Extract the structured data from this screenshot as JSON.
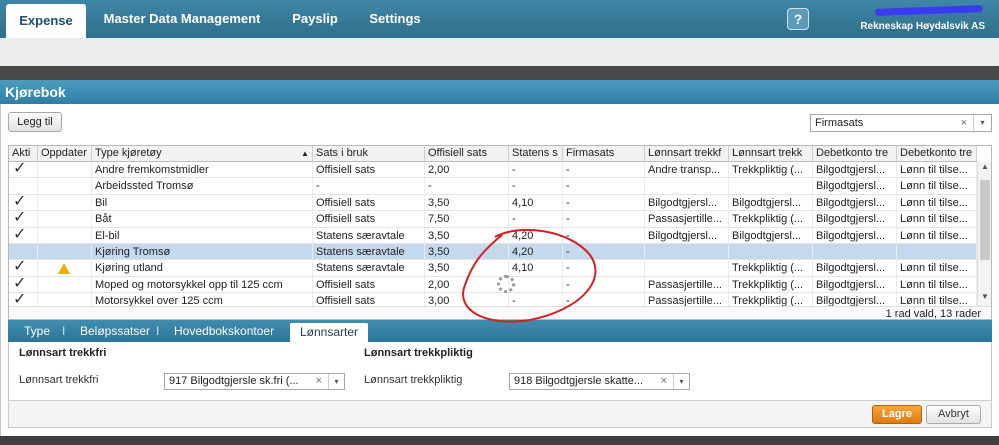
{
  "nav": {
    "tabs": [
      "Expense",
      "Master Data Management",
      "Payslip",
      "Settings"
    ],
    "help": "?",
    "company": "Rekneskap Høydalsvik AS"
  },
  "panel": {
    "title": "Kjørebok",
    "add_button": "Legg til",
    "filter_value": "Firmasats",
    "clear": "×",
    "dropdown": "▾"
  },
  "grid": {
    "columns": [
      "Akti",
      "Oppdater",
      "Type kjøretøy",
      "Sats i bruk",
      "Offisiell sats",
      "Statens s",
      "Firmasats",
      "Lønnsart trekkf",
      "Lønnsart trekk",
      "Debetkonto tre",
      "Debetkonto tre"
    ],
    "sort_indicator": "▲",
    "rows": [
      {
        "active": "✓",
        "warn": false,
        "type": "Andre fremkomstmidler",
        "sats": "Offisiell sats",
        "off": "2,00",
        "stat": "-",
        "firma": "-",
        "lf": "Andre transp...",
        "lt": "Trekkpliktig (...",
        "d1": "Bilgodtgjersl...",
        "d2": "Lønn til tilse..."
      },
      {
        "active": "",
        "warn": false,
        "type": "Arbeidssted Tromsø",
        "sats": "-",
        "off": "-",
        "stat": "-",
        "firma": "-",
        "lf": "",
        "lt": "",
        "d1": "Bilgodtgjersl...",
        "d2": "Lønn til tilse..."
      },
      {
        "active": "✓",
        "warn": false,
        "type": "Bil",
        "sats": "Offisiell sats",
        "off": "3,50",
        "stat": "4,10",
        "firma": "-",
        "lf": "Bilgodtgjersl...",
        "lt": "Bilgodtgjersl...",
        "d1": "Bilgodtgjersl...",
        "d2": "Lønn til tilse..."
      },
      {
        "active": "✓",
        "warn": false,
        "type": "Båt",
        "sats": "Offisiell sats",
        "off": "7,50",
        "stat": "-",
        "firma": "-",
        "lf": "Passasjertille...",
        "lt": "Trekkpliktig (...",
        "d1": "Bilgodtgjersl...",
        "d2": "Lønn til tilse..."
      },
      {
        "active": "✓",
        "warn": false,
        "type": "El-bil",
        "sats": "Statens særavtale",
        "off": "3,50",
        "stat": "4,20",
        "firma": "-",
        "lf": "Bilgodtgjersl...",
        "lt": "Bilgodtgjersl...",
        "d1": "Bilgodtgjersl...",
        "d2": "Lønn til tilse..."
      },
      {
        "active": "",
        "warn": false,
        "type": "Kjøring Tromsø",
        "sats": "Statens særavtale",
        "off": "3,50",
        "stat": "4,20",
        "firma": "-",
        "lf": "",
        "lt": "",
        "d1": "",
        "d2": ""
      },
      {
        "active": "✓",
        "warn": true,
        "type": "Kjøring utland",
        "sats": "Statens særavtale",
        "off": "3,50",
        "stat": "4,10",
        "firma": "-",
        "lf": "",
        "lt": "Trekkpliktig (...",
        "d1": "Bilgodtgjersl...",
        "d2": "Lønn til tilse..."
      },
      {
        "active": "✓",
        "warn": false,
        "type": "Moped og motorsykkel opp til 125 ccm",
        "sats": "Offisiell sats",
        "off": "2,00",
        "stat": "-",
        "firma": "-",
        "lf": "Passasjertille...",
        "lt": "Trekkpliktig (...",
        "d1": "Bilgodtgjersl...",
        "d2": "Lønn til tilse..."
      },
      {
        "active": "✓",
        "warn": false,
        "type": "Motorsykkel over 125 ccm",
        "sats": "Offisiell sats",
        "off": "3,00",
        "stat": "-",
        "firma": "-",
        "lf": "Passasjertille...",
        "lt": "Trekkpliktig (...",
        "d1": "Bilgodtgjersl...",
        "d2": "Lønn til tilse..."
      }
    ],
    "selected_index": 5,
    "footer": "1 rad vald, 13 rader"
  },
  "tabs": [
    "Type",
    "Beløpssatser",
    "Hovedbokskontoer",
    "Lønnsarter"
  ],
  "tab_sep": "I",
  "detail": {
    "left_title": "Lønnsart trekkfri",
    "left_label": "Lønnsart trekkfri",
    "left_value": "917 Bilgodtgjersle sk.fri (...",
    "right_title": "Lønnsart trekkpliktig",
    "right_label": "Lønnsart trekkpliktig",
    "right_value": "918 Bilgodtgjersle skatte..."
  },
  "actions": {
    "save": "Lagre",
    "cancel": "Avbryt"
  },
  "colors": {
    "accent": "#2f7ea6",
    "save": "#e88a1c",
    "annotation": "#d42020",
    "selection": "#c5d9ee"
  }
}
